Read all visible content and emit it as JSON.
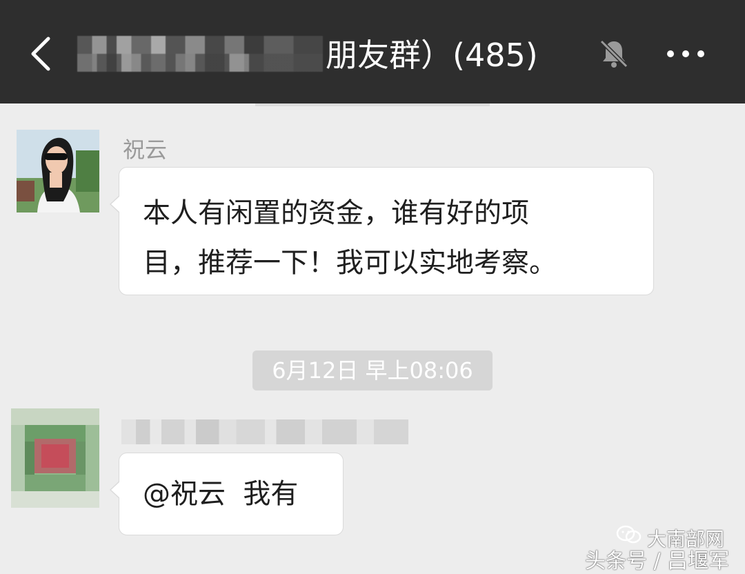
{
  "header": {
    "title_suffix": "朋友群）(485)",
    "back_icon": "chevron-left-icon",
    "mute_icon": "bell-muted-icon",
    "more_icon": "more-dots-icon",
    "background_color": "#2e2e2e"
  },
  "messages": [
    {
      "sender": "祝云",
      "avatar": "profile-photo",
      "lines": [
        "本人有闲置的资金，谁有好的项",
        "目，推荐一下！我可以实地考察。"
      ]
    },
    {
      "timestamp": "6月12日 早上08:06"
    },
    {
      "sender_name_blurred": true,
      "avatar": "blurred-avatar",
      "text": "@祝云  我有"
    }
  ],
  "watermark": {
    "line1": "大南部网",
    "line2": "头条号 / 吕堰军"
  },
  "colors": {
    "chat_background": "#ededed",
    "bubble": "#ffffff",
    "timestamp_pill": "#d6d6d6"
  }
}
